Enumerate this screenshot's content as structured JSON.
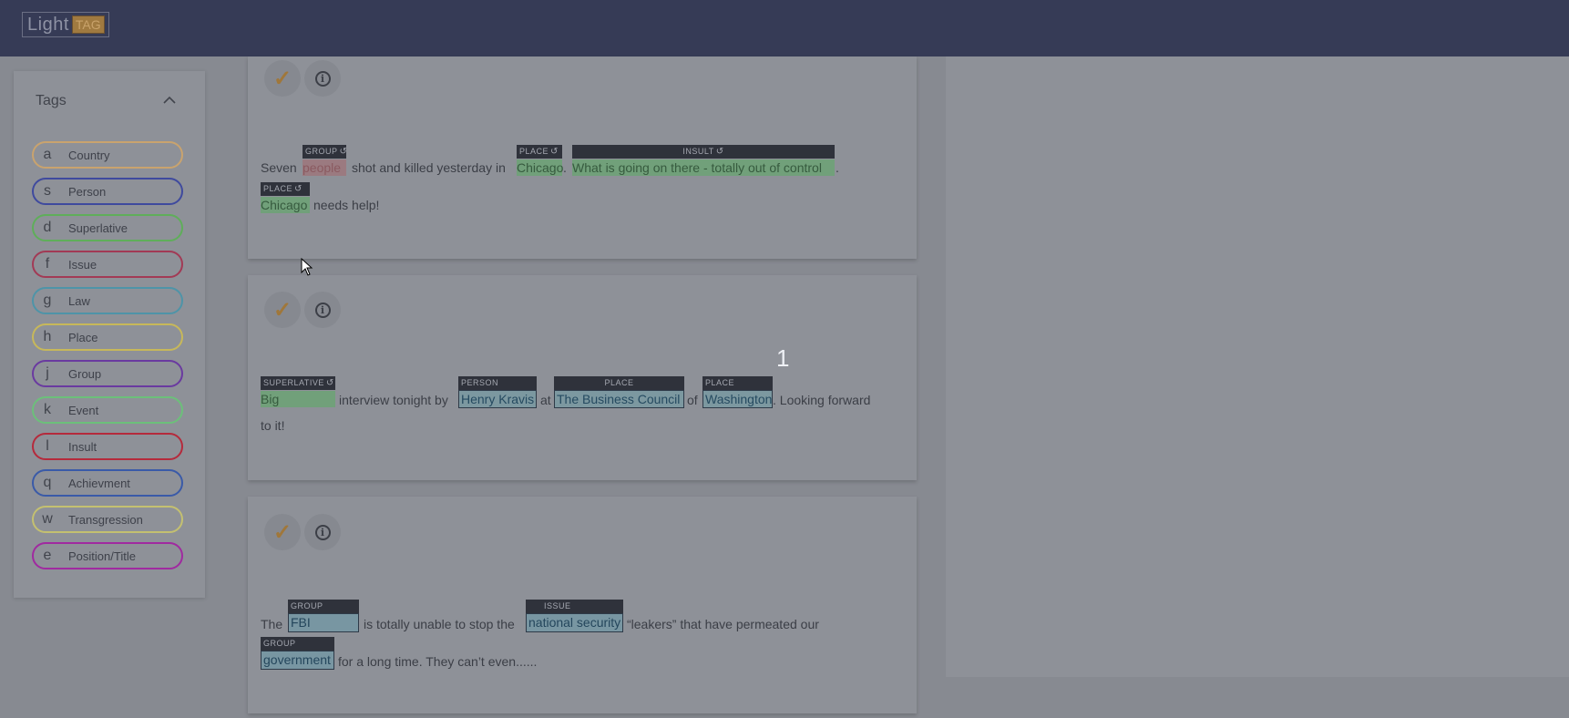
{
  "app": {
    "logo_light": "Light",
    "logo_tag": "TAG"
  },
  "sidebar": {
    "title": "Tags",
    "collapse_icon": "chevron-up-icon",
    "tags": [
      {
        "key": "a",
        "label": "Country",
        "color": "#c9a36e"
      },
      {
        "key": "s",
        "label": "Person",
        "color": "#3f4a9e"
      },
      {
        "key": "d",
        "label": "Superlative",
        "color": "#5fae5a"
      },
      {
        "key": "f",
        "label": "Issue",
        "color": "#a23a55"
      },
      {
        "key": "g",
        "label": "Law",
        "color": "#4e94a8"
      },
      {
        "key": "h",
        "label": "Place",
        "color": "#c7b85a"
      },
      {
        "key": "j",
        "label": "Group",
        "color": "#6a3aa0"
      },
      {
        "key": "k",
        "label": "Event",
        "color": "#6cc07a"
      },
      {
        "key": "l",
        "label": "Insult",
        "color": "#b52a3c"
      },
      {
        "key": "q",
        "label": "Achievment",
        "color": "#3a5aa8"
      },
      {
        "key": "w",
        "label": "Transgression",
        "color": "#c4c070"
      },
      {
        "key": "e",
        "label": "Position/Title",
        "color": "#a02aa0"
      }
    ]
  },
  "documents": [
    {
      "texts": {
        "t1": "Seven",
        "t2": "shot and killed yesterday in",
        "t3": ".",
        "t4": ".",
        "t5": "needs help!"
      },
      "annotations": {
        "a1": {
          "text": "people",
          "label": "GROUP"
        },
        "a2": {
          "text": "Chicago",
          "label": "PLACE"
        },
        "a3": {
          "text": "What is going on there - totally out of control",
          "label": "INSULT"
        },
        "a4": {
          "text": "Chicago",
          "label": "PLACE"
        }
      }
    },
    {
      "texts": {
        "t1": "interview tonight by",
        "t2": "at",
        "t3": "of",
        "t4": ". Looking forward",
        "t5": "to it!"
      },
      "annotations": {
        "a1": {
          "text": "Big",
          "label": "SUPERLATIVE"
        },
        "a2": {
          "text": "Henry Kravis",
          "label": "PERSON"
        },
        "a3": {
          "text": "The Business Council",
          "label": "PLACE"
        },
        "a4": {
          "text": "Washington",
          "label": "PLACE"
        }
      }
    },
    {
      "texts": {
        "t1": "The",
        "t2": "is totally unable to stop the",
        "t3": "“leakers” that have permeated our",
        "t4": "for a long time. They can’t even......"
      },
      "annotations": {
        "a1": {
          "text": "FBI",
          "label": "GROUP"
        },
        "a2": {
          "text": "national security",
          "label": "ISSUE"
        },
        "a3": {
          "text": "government",
          "label": "GROUP"
        }
      }
    }
  ],
  "counter": "1"
}
